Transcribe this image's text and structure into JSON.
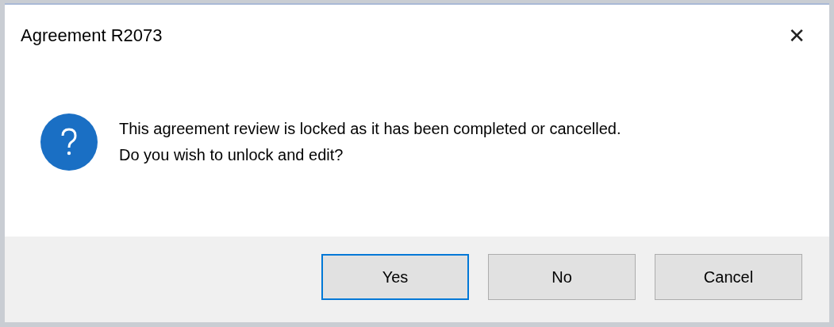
{
  "window": {
    "title": "Agreement R2073",
    "close": "✕"
  },
  "message": {
    "lines": [
      "This agreement review is locked as it has been completed or cancelled.",
      "Do you wish to unlock and edit?"
    ]
  },
  "buttons": [
    {
      "label": "Yes",
      "default": true
    },
    {
      "label": "No",
      "default": false
    },
    {
      "label": "Cancel",
      "default": false
    }
  ]
}
